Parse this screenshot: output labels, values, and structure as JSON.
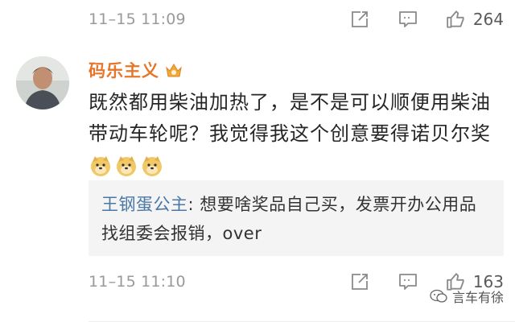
{
  "top_comment": {
    "timestamp": "11–15 11:09",
    "likes": "264"
  },
  "comment": {
    "username": "码乐主义",
    "badge_icon": "vip-crown-icon",
    "text": "既然都用柴油加热了，是不是可以顺便用柴油带动车轮呢？我觉得我这个创意要得诺贝尔奖",
    "emojis": [
      "doge-emoji",
      "doge-emoji",
      "doge-emoji"
    ],
    "timestamp": "11–15 11:10",
    "likes": "163",
    "reply": {
      "author": "王钢蛋公主",
      "separator": ": ",
      "text": "想要啥奖品自己买，发票开办公用品找组委会报销，over"
    }
  },
  "watermark": {
    "text": "言车有徐",
    "icon": "wechat-icon"
  },
  "colors": {
    "username": "#e6762b",
    "reply_author": "#4a78a6",
    "reply_bg": "#f4f4f4",
    "meta_text": "#9a9a9a"
  }
}
